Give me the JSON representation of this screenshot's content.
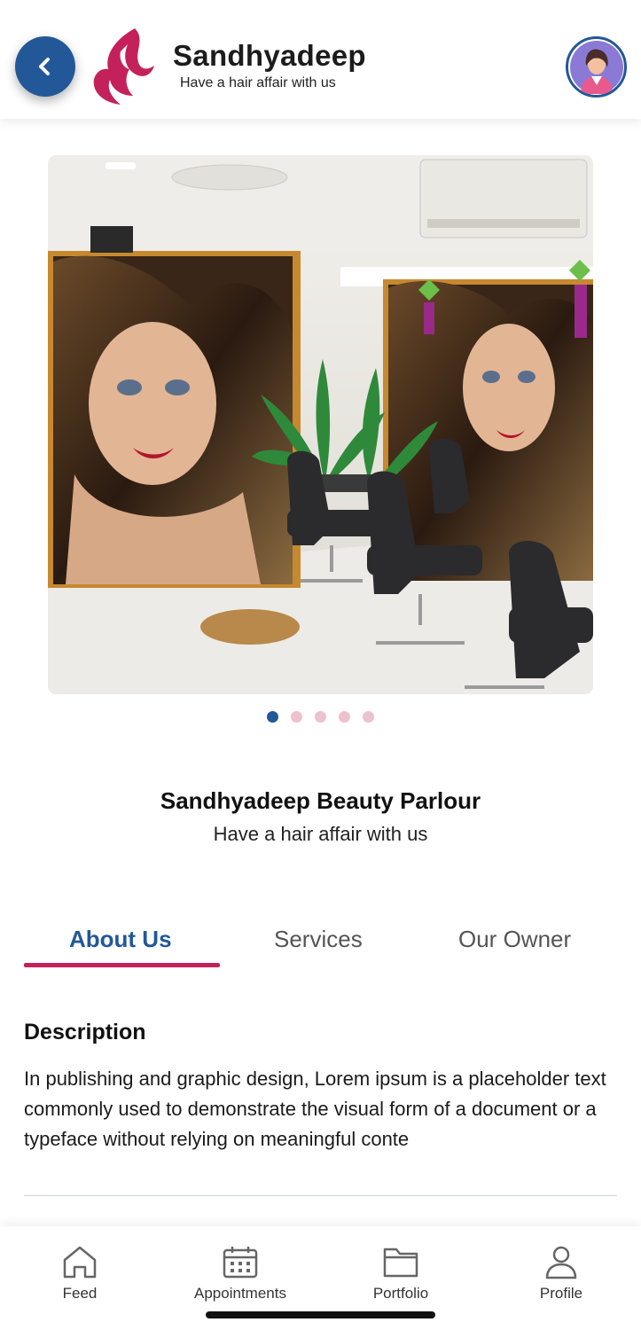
{
  "header": {
    "brand_name": "Sandhyadeep",
    "brand_tagline": "Have a hair affair with us",
    "back_icon": "chevron-left-icon",
    "avatar_icon": "user-avatar",
    "accent": "#235898",
    "brand_color": "#c4215a"
  },
  "carousel": {
    "slide_count": 5,
    "active_index": 0
  },
  "business": {
    "name": "Sandhyadeep Beauty Parlour",
    "tagline": "Have a hair affair with us"
  },
  "tabs": [
    {
      "label": "About Us",
      "active": true
    },
    {
      "label": "Services",
      "active": false
    },
    {
      "label": "Our Owner",
      "active": false
    }
  ],
  "about": {
    "heading": "Description",
    "text": "In publishing and graphic design, Lorem ipsum is a placeholder text commonly used to demonstrate the visual form of a document or a typeface without relying on meaningful conte"
  },
  "bottom_nav": [
    {
      "label": "Feed",
      "icon": "home-icon"
    },
    {
      "label": "Appointments",
      "icon": "calendar-icon"
    },
    {
      "label": "Portfolio",
      "icon": "folder-icon"
    },
    {
      "label": "Profile",
      "icon": "user-icon"
    }
  ]
}
